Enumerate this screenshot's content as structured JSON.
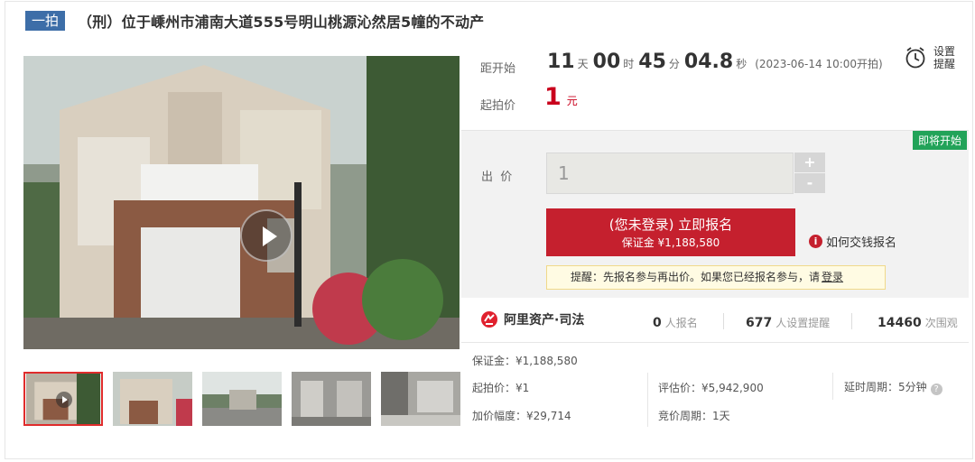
{
  "header": {
    "tag": "一拍",
    "title": "（刑）位于嵊州市浦南大道555号明山桃源沁然居5幢的不动产"
  },
  "countdown": {
    "label": "距开始",
    "days": "11",
    "days_unit": "天",
    "hours": "00",
    "hours_unit": "时",
    "minutes": "45",
    "minutes_unit": "分",
    "seconds": "04.8",
    "seconds_unit": "秒",
    "start_time": "(2023-06-14 10:00开拍)"
  },
  "reminder": {
    "label": "设置提醒",
    "icon": "alarm-clock-icon"
  },
  "start_price": {
    "label": "起拍价",
    "value": "1",
    "unit": "元"
  },
  "bid": {
    "badge": "即将开始",
    "label": "出  价",
    "input_value": "1",
    "plus": "+",
    "minus": "-",
    "signup_main": "(您未登录) 立即报名",
    "signup_sub": "保证金 ¥1,188,580",
    "howto": "如何交钱报名",
    "notice": "提醒：先报名参与再出价。如果您已经报名参与，请",
    "notice_link": "登录"
  },
  "stats": {
    "brand": "阿里资产·司法",
    "signups": "0",
    "signups_label": "人报名",
    "reminders": "677",
    "reminders_label": "人设置提醒",
    "views": "14460",
    "views_label": "次围观"
  },
  "details": {
    "deposit": "保证金：¥1,188,580",
    "start_price": "起拍价：¥1",
    "increment": "加价幅度：¥29,714",
    "valuation": "评估价：¥5,942,900",
    "cycle": "竞价周期：1天",
    "extension": "延时周期：5分钟"
  },
  "colors": {
    "tag": "#3d6ea8",
    "price_red": "#c9001c",
    "button_red": "#c5202e",
    "badge_green": "#22a359"
  }
}
